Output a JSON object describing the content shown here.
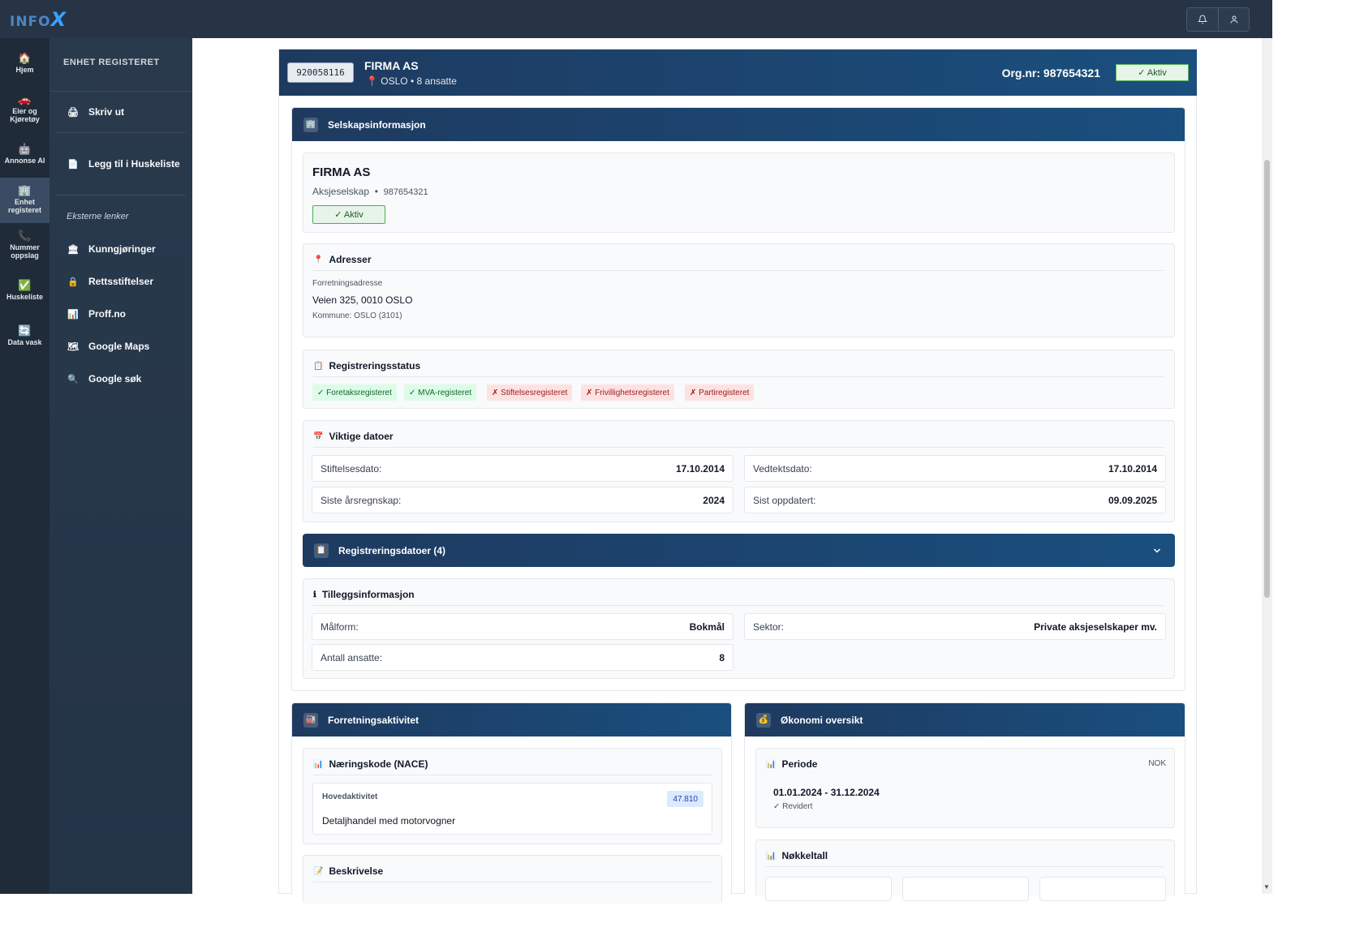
{
  "app": {
    "logo_text": "INFO",
    "logo_x": "X",
    "notifications_icon": "bell-icon",
    "user_icon": "user-icon"
  },
  "rail": [
    {
      "label": "Hjem",
      "icon": "🏠"
    },
    {
      "label": "Eier og Kjøretøy",
      "icon": "🚗"
    },
    {
      "label": "Annonse AI",
      "icon": "🤖"
    },
    {
      "label": "Enhet registeret",
      "icon": "🏢"
    },
    {
      "label": "Nummer oppslag",
      "icon": "📞"
    },
    {
      "label": "Huskeliste",
      "icon": "✅"
    },
    {
      "label": "Data vask",
      "icon": "🔄"
    }
  ],
  "sidebar": {
    "title": "ENHET REGISTERET",
    "print_label": "Skriv ut",
    "print_icon": "🖨",
    "add_label": "Legg til i Huskeliste",
    "add_icon": "📄",
    "external_title": "Eksterne lenker",
    "links": [
      {
        "label": "Kunngjøringer",
        "icon": "🏛"
      },
      {
        "label": "Rettsstiftelser",
        "icon": "🔒"
      },
      {
        "label": "Proff.no",
        "icon": "📊"
      },
      {
        "label": "Google Maps",
        "icon": "🗺"
      },
      {
        "label": "Google søk",
        "icon": "🔍"
      }
    ]
  },
  "header": {
    "id": "920058116",
    "name": "FIRMA AS",
    "location_icon": "📍",
    "location": "OSLO • 8 ansatte",
    "org_nr": "Org.nr: 987654321",
    "status": "✓ Aktiv"
  },
  "company": {
    "section_title": "Selskapsinformasjon",
    "section_icon": "🏢",
    "name": "FIRMA AS",
    "type": "Aksjeselskap",
    "dot": "•",
    "org": "987654321",
    "status": "✓ Aktiv"
  },
  "address": {
    "title": "Adresser",
    "icon": "📍",
    "label": "Forretningsadresse",
    "street": "Veien 325, 0010 OSLO",
    "municipality": "Kommune: OSLO (3101)"
  },
  "registration": {
    "title": "Registreringsstatus",
    "icon": "📋",
    "tags": [
      {
        "label": "✓ Foretaksregisteret",
        "ok": true
      },
      {
        "label": "✓ MVA-registeret",
        "ok": true
      },
      {
        "label": "✗ Stiftelsesregisteret",
        "ok": false
      },
      {
        "label": "✗ Frivillighetsregisteret",
        "ok": false
      },
      {
        "label": "✗ Partiregisteret",
        "ok": false
      }
    ]
  },
  "dates": {
    "title": "Viktige datoer",
    "icon": "📅",
    "stiftelse_label": "Stiftelsesdato:",
    "stiftelse_value": "17.10.2014",
    "vedtekt_label": "Vedtektsdato:",
    "vedtekt_value": "17.10.2014",
    "regnskap_label": "Siste årsregnskap:",
    "regnskap_value": "2024",
    "oppdatert_label": "Sist oppdatert:",
    "oppdatert_value": "09.09.2025"
  },
  "reg_dates": {
    "title": "Registreringsdatoer (4)",
    "icon": "📋",
    "chevron": "chevron-down-icon"
  },
  "extra": {
    "title": "Tilleggsinformasjon",
    "icon": "ℹ",
    "malform_label": "Målform:",
    "malform_value": "Bokmål",
    "sektor_label": "Sektor:",
    "sektor_value": "Private aksjeselskaper mv.",
    "ansatte_label": "Antall ansatte:",
    "ansatte_value": "8"
  },
  "business": {
    "section_title": "Forretningsaktivitet",
    "section_icon": "🏭",
    "nace_title": "Næringskode (NACE)",
    "nace_icon": "📊",
    "main_label": "Hovedaktivitet",
    "code": "47.810",
    "description": "Detaljhandel med motorvogner",
    "desc_title": "Beskrivelse",
    "desc_icon": "📝"
  },
  "economy": {
    "section_title": "Økonomi oversikt",
    "section_icon": "💰",
    "period_title": "Periode",
    "period_icon": "📊",
    "currency": "NOK",
    "period": "01.01.2024 - 31.12.2024",
    "audited": "✓ Revidert",
    "key_title": "Nøkkeltall",
    "key_icon": "📊"
  }
}
